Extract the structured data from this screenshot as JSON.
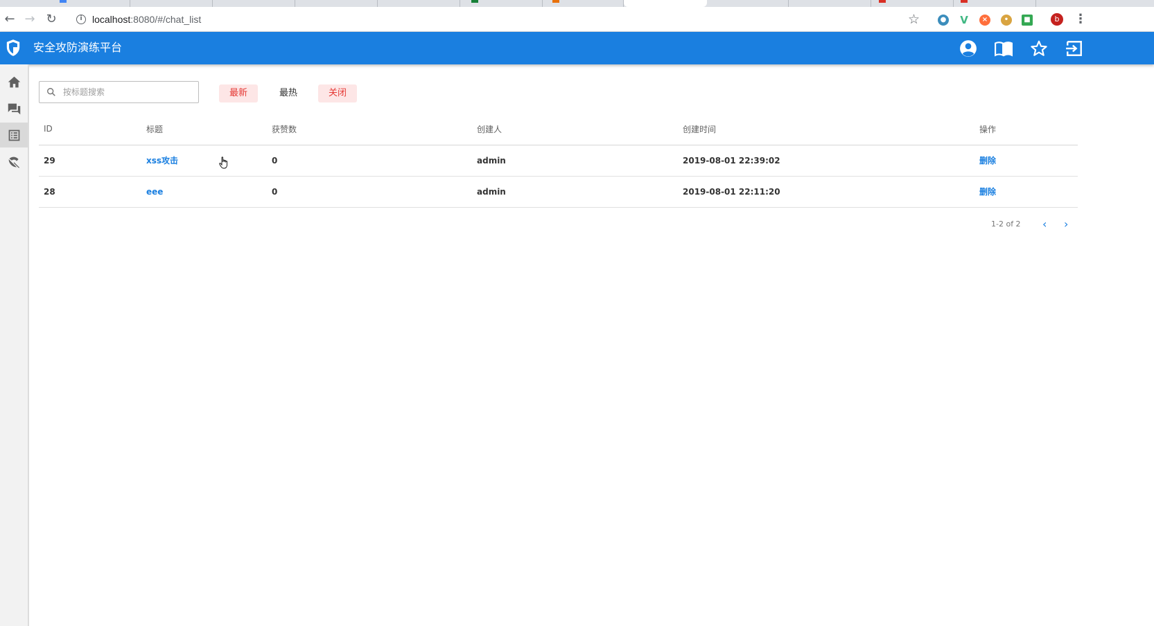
{
  "browser": {
    "url_host": "localhost",
    "url_path": ":8080/#/chat_list",
    "profile_initial": "b"
  },
  "app": {
    "title": "安全攻防演练平台",
    "brand_color": "#1a7fe0"
  },
  "filters": {
    "search_placeholder": "按标题搜索",
    "latest": "最新",
    "hottest": "最热",
    "closed": "关闭"
  },
  "table": {
    "headers": [
      "ID",
      "标题",
      "获赞数",
      "创建人",
      "创建时间",
      "操作"
    ],
    "rows": [
      {
        "id": "29",
        "title": "xss攻击",
        "likes": "0",
        "creator": "admin",
        "created": "2019-08-01 22:39:02",
        "action": "删除"
      },
      {
        "id": "28",
        "title": "eee",
        "likes": "0",
        "creator": "admin",
        "created": "2019-08-01 22:11:20",
        "action": "删除"
      }
    ]
  },
  "pagination": {
    "summary": "1-2 of 2"
  }
}
